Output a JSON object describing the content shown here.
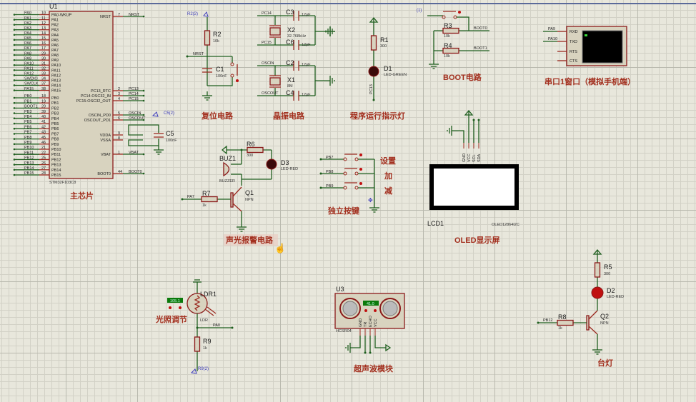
{
  "colors": {
    "wire": "#1f5f1f",
    "component": "#8b1a1a",
    "title": "#a3301f",
    "background": "#e8e7dc"
  },
  "mcu": {
    "ref": "U1",
    "part": "STM32F103C8",
    "title": "主芯片",
    "left_pins": [
      {
        "net": "PA0",
        "num": "10",
        "name": "PA0-WKUP"
      },
      {
        "net": "PA1",
        "num": "11",
        "name": "PA1"
      },
      {
        "net": "PA2",
        "num": "12",
        "name": "PA2"
      },
      {
        "net": "PA3",
        "num": "13",
        "name": "PA3"
      },
      {
        "net": "PA4",
        "num": "14",
        "name": "PA4"
      },
      {
        "net": "PA5",
        "num": "15",
        "name": "PA5"
      },
      {
        "net": "PA6",
        "num": "16",
        "name": "PA6"
      },
      {
        "net": "PA7",
        "num": "17",
        "name": "PA7"
      },
      {
        "net": "PA8",
        "num": "29",
        "name": "PA8"
      },
      {
        "net": "PA9",
        "num": "30",
        "name": "PA9"
      },
      {
        "net": "PA10",
        "num": "31",
        "name": "PA10"
      },
      {
        "net": "PA11",
        "num": "32",
        "name": "PA11"
      },
      {
        "net": "PA12",
        "num": "33",
        "name": "PA12"
      },
      {
        "net": "SWDIO",
        "num": "34",
        "name": "PA13"
      },
      {
        "net": "SWCLK",
        "num": "37",
        "name": "PA14"
      },
      {
        "net": "PA15",
        "num": "38",
        "name": "PA15"
      },
      {
        "net": "PB0",
        "num": "18",
        "name": "PB0"
      },
      {
        "net": "PB1",
        "num": "19",
        "name": "PB1"
      },
      {
        "net": "BOOT1",
        "num": "20",
        "name": "PB2"
      },
      {
        "net": "PB3",
        "num": "39",
        "name": "PB3"
      },
      {
        "net": "PB4",
        "num": "40",
        "name": "PB4"
      },
      {
        "net": "PB5",
        "num": "41",
        "name": "PB5"
      },
      {
        "net": "PB6",
        "num": "42",
        "name": "PB6"
      },
      {
        "net": "PB7",
        "num": "43",
        "name": "PB7"
      },
      {
        "net": "PB8",
        "num": "45",
        "name": "PB8"
      },
      {
        "net": "PB9",
        "num": "46",
        "name": "PB9"
      },
      {
        "net": "PB10",
        "num": "21",
        "name": "PB10"
      },
      {
        "net": "PB11",
        "num": "22",
        "name": "PB11"
      },
      {
        "net": "PB12",
        "num": "25",
        "name": "PB12"
      },
      {
        "net": "PB13",
        "num": "26",
        "name": "PB13"
      },
      {
        "net": "PB14",
        "num": "27",
        "name": "PB14"
      },
      {
        "net": "PB15",
        "num": "28",
        "name": "PB15"
      }
    ],
    "right_pins": [
      {
        "net": "NRST",
        "num": "7",
        "name": "NRST"
      },
      {
        "net": "PC13",
        "num": "2",
        "name": "PC13_RTC"
      },
      {
        "net": "PC14",
        "num": "3",
        "name": "PC14-OSC32_IN"
      },
      {
        "net": "PC15",
        "num": "4",
        "name": "PC15-OSC32_OUT"
      },
      {
        "net": "OSCIN",
        "num": "5",
        "name": "OSCIN_PD0"
      },
      {
        "net": "OSCOUT",
        "num": "6",
        "name": "OSCOUT_PD1"
      },
      {
        "net": "",
        "num": "9",
        "name": "VDDA"
      },
      {
        "net": "",
        "num": "8",
        "name": "VSSA"
      },
      {
        "net": "VBAT",
        "num": "1",
        "name": "VBAT"
      },
      {
        "net": "BOOT0",
        "num": "44",
        "name": "BOOT0"
      }
    ],
    "c5": {
      "ref": "C5",
      "value": "100nF",
      "probe": "C5(2)"
    }
  },
  "reset": {
    "title": "复位电路",
    "probe": "R2(2)",
    "r2": {
      "ref": "R2",
      "value": "10k"
    },
    "c1": {
      "ref": "C1",
      "value": "100nF"
    },
    "net": "NRST"
  },
  "crystal": {
    "title": "晶振电路",
    "c3": {
      "ref": "C3",
      "value": "12pF"
    },
    "c6": {
      "ref": "C6",
      "value": "12pF"
    },
    "x2": {
      "ref": "X2",
      "value": "32.768kHz"
    },
    "c2": {
      "ref": "C2",
      "value": "12pF"
    },
    "c4": {
      "ref": "C4",
      "value": "12pF"
    },
    "x1": {
      "ref": "X1",
      "value": "8M"
    },
    "nets": [
      "PC14",
      "PC15",
      "OSCIN",
      "OSCOUT"
    ]
  },
  "run_led": {
    "title": "程序运行指示灯",
    "r1": {
      "ref": "R1",
      "value": "300"
    },
    "d1": {
      "ref": "D1",
      "value": "LED-GREEN"
    },
    "net": "PC13"
  },
  "boot": {
    "title": "BOOT电路",
    "probe": "(1)",
    "r3": {
      "ref": "R3",
      "value": "10k"
    },
    "r4": {
      "ref": "R4",
      "value": "10k"
    },
    "nets": [
      "BOOT0",
      "BOOT1"
    ]
  },
  "serial": {
    "title": "串口1窗口（模拟手机端）",
    "pins": [
      "RXD",
      "TXD",
      "RTS",
      "CTS"
    ],
    "nets": [
      "PA9",
      "PA10"
    ]
  },
  "alarm": {
    "title": "声光报警电路",
    "r6": {
      "ref": "R6",
      "value": "300"
    },
    "d3": {
      "ref": "D3",
      "value": "LED-RED"
    },
    "buz": {
      "ref": "BUZ1",
      "value": "BUZZER"
    },
    "q1": {
      "ref": "Q1",
      "value": "NPN"
    },
    "r7": {
      "ref": "R7",
      "value": "1k"
    },
    "net": "PA7"
  },
  "keys": {
    "title": "独立按键",
    "nets": [
      "PB7",
      "PB8",
      "PB9"
    ],
    "labels": [
      "设置",
      "加",
      "减"
    ]
  },
  "oled": {
    "title": "OLED显示屏",
    "ref": "LCD1",
    "part": "OLED12864I2C",
    "pins": [
      "GND",
      "VCC",
      "SCL",
      "SDA"
    ]
  },
  "light": {
    "title": "光照调节",
    "ldr": {
      "ref": "LDR1",
      "value": "LDR"
    },
    "reading": "105.1",
    "r9": {
      "ref": "R9",
      "value": "1k"
    },
    "net": "PA0",
    "probe": "R9(2)"
  },
  "ultrasonic": {
    "title": "超声波模块",
    "ref": "U3",
    "part": "HCSR04",
    "reading": "41.0",
    "pins": [
      "GND",
      "TR",
      "ECHO",
      "VCC"
    ]
  },
  "lamp": {
    "title": "台灯",
    "r5": {
      "ref": "R5",
      "value": "300"
    },
    "d2": {
      "ref": "D2",
      "value": "LED-RED"
    },
    "q2": {
      "ref": "Q2",
      "value": "NPN"
    },
    "r8": {
      "ref": "R8",
      "value": "1k"
    },
    "net": "PB12"
  }
}
